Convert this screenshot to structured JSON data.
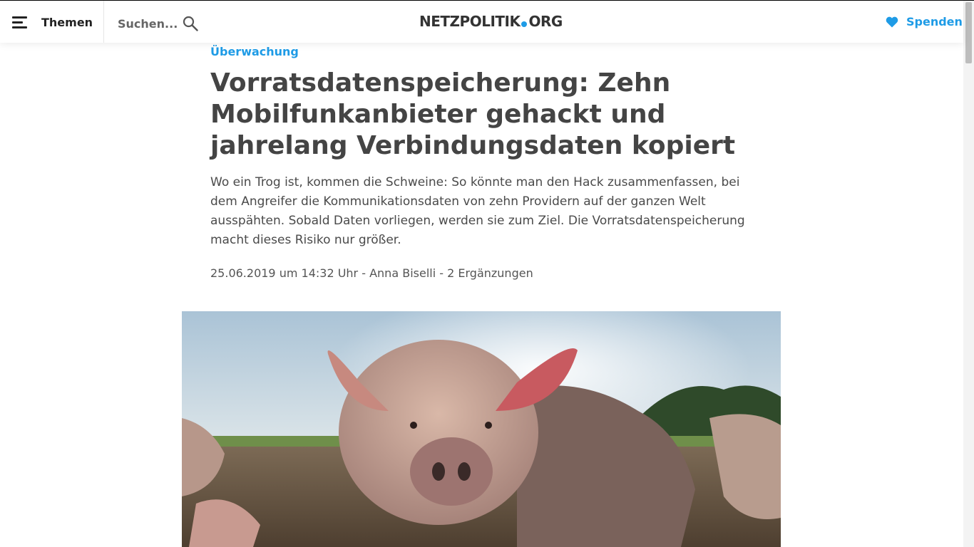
{
  "header": {
    "menu_label": "Themen",
    "search_placeholder": "Suchen...",
    "logo_left": "NETZPOLITIK",
    "logo_right": "ORG",
    "donate_label": "Spenden"
  },
  "article": {
    "category": "Überwachung",
    "title": "Vorratsdatenspeicherung: Zehn Mobilfunkanbieter gehackt und jahrelang Verbindungsdaten kopiert",
    "teaser": "Wo ein Trog ist, kommen die Schweine: So könnte man den Hack zusammenfassen, bei dem Angreifer die Kommunikationsdaten von zehn Providern auf der ganzen Welt ausspähten. Sobald Daten vorliegen, werden sie zum Ziel. Die Vorratsdatenspeicherung macht dieses Risiko nur größer.",
    "date": "25.06.2019 um 14:32 Uhr",
    "separator": " - ",
    "author": "Anna Biselli",
    "comments": "2 Ergänzungen"
  },
  "colors": {
    "accent": "#1e9be6",
    "heading": "#444444",
    "text": "#4a4a4a"
  },
  "icons": {
    "menu": "hamburger-icon",
    "search": "search-icon",
    "donate": "heart-icon"
  }
}
